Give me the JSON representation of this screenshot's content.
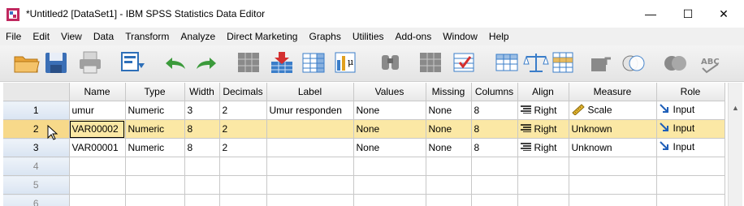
{
  "window": {
    "title": "*Untitled2 [DataSet1] - IBM SPSS Statistics Data Editor",
    "controls": {
      "minimize": "—",
      "maximize": "☐",
      "close": "✕"
    }
  },
  "menu": [
    "File",
    "Edit",
    "View",
    "Data",
    "Transform",
    "Analyze",
    "Direct Marketing",
    "Graphs",
    "Utilities",
    "Add-ons",
    "Window",
    "Help"
  ],
  "toolbar_icons": [
    "open-icon",
    "save-icon",
    "print-icon",
    "dialog-recall-icon",
    "undo-icon",
    "redo-icon",
    "goto-case-icon",
    "goto-variable-icon",
    "variables-icon",
    "run-descriptives-icon",
    "find-icon",
    "insert-cases-icon",
    "insert-variable-icon",
    "split-file-icon",
    "weight-cases-icon",
    "select-cases-icon",
    "value-labels-icon",
    "use-variable-sets-icon",
    "show-all-variables-icon",
    "spell-check-icon"
  ],
  "columns": [
    "Name",
    "Type",
    "Width",
    "Decimals",
    "Label",
    "Values",
    "Missing",
    "Columns",
    "Align",
    "Measure",
    "Role"
  ],
  "rows": [
    {
      "num": "1",
      "name": "umur",
      "type": "Numeric",
      "width": "3",
      "decimals": "2",
      "label": "Umur responden",
      "values": "None",
      "missing": "None",
      "columns": "8",
      "align": "Right",
      "measure": "Scale",
      "role": "Input"
    },
    {
      "num": "2",
      "name": "VAR00002",
      "type": "Numeric",
      "width": "8",
      "decimals": "2",
      "label": "",
      "values": "None",
      "missing": "None",
      "columns": "8",
      "align": "Right",
      "measure": "Unknown",
      "role": "Input"
    },
    {
      "num": "3",
      "name": "VAR00001",
      "type": "Numeric",
      "width": "8",
      "decimals": "2",
      "label": "",
      "values": "None",
      "missing": "None",
      "columns": "8",
      "align": "Right",
      "measure": "Unknown",
      "role": "Input"
    }
  ],
  "empty_rows": [
    "4",
    "5",
    "6"
  ],
  "selected_row": "2",
  "colors": {
    "selected_row": "#fbe8a5",
    "row_header": "#d9e4f2",
    "role_arrow": "#1f5fb8",
    "ruler": "#d4a017"
  }
}
